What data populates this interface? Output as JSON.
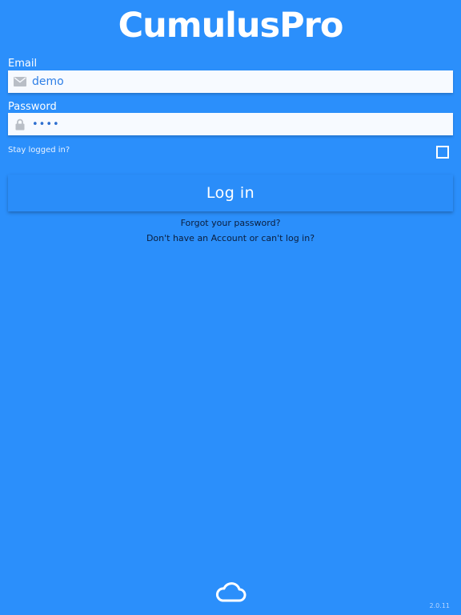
{
  "app": {
    "logo_text": "CumulusPro",
    "version": "2.0.11"
  },
  "login": {
    "email_label": "Email",
    "email_value": "demo",
    "password_label": "Password",
    "password_value": "••••",
    "stay_logged_in_label": "Stay logged in?",
    "stay_logged_in_checked": false,
    "login_button_label": "Log in",
    "forgot_password_link": "Forgot your password?",
    "no_account_link": "Don't have an Account or can't log in?"
  },
  "icons": {
    "email": "mail-icon",
    "password": "lock-icon",
    "footer": "cloud-icon"
  },
  "colors": {
    "background": "#2b8ffb",
    "field_background": "#f7faff",
    "field_text": "#2e7fe6",
    "link_text": "#0b1e3d"
  }
}
